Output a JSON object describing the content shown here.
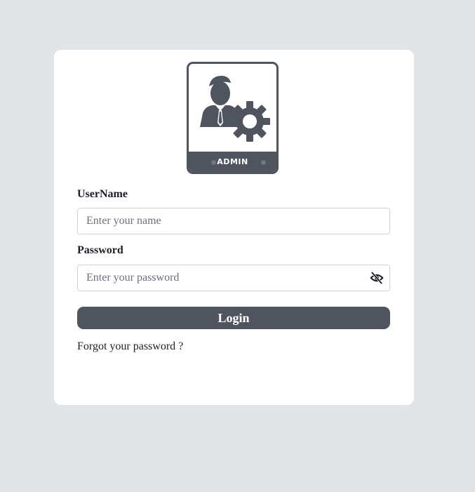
{
  "logo": {
    "icon": "admin-user-gear-icon",
    "badge_text": "ADMIN"
  },
  "form": {
    "username": {
      "label": "UserName",
      "placeholder": "Enter your name",
      "value": ""
    },
    "password": {
      "label": "Password",
      "placeholder": "Enter your password",
      "value": "",
      "toggle_icon": "eye-off-icon"
    },
    "login_label": "Login",
    "forgot_label": "Forgot your password ?"
  },
  "colors": {
    "background": "#e2e5e8",
    "card": "#ffffff",
    "accent": "#50545f"
  }
}
